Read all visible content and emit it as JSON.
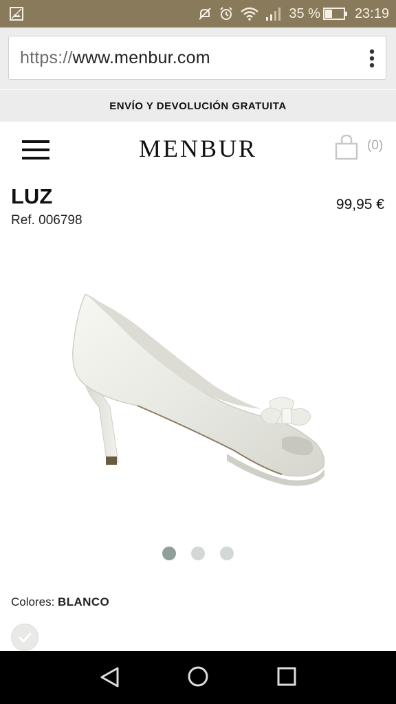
{
  "status_bar": {
    "battery_percent": "35 %",
    "time": "23:19",
    "background": "#8a7a5c",
    "icons": [
      "image-icon",
      "mute-icon",
      "alarm-icon",
      "wifi-icon",
      "signal-icon",
      "battery-icon"
    ]
  },
  "browser": {
    "url_scheme": "https://",
    "url_host": "www.menbur.com"
  },
  "promo": {
    "text": "ENVÍO Y DEVOLUCIÓN GRATUITA"
  },
  "header": {
    "logo": "MENBUR",
    "cart_count": "(0)"
  },
  "product": {
    "name": "LUZ",
    "ref": "Ref. 006798",
    "price": "99,95 €",
    "gallery": {
      "total_images": 3,
      "active_index": 0
    },
    "colors_label": "Colores:",
    "colors_value": "BLANCO"
  },
  "nav_bar": {
    "icons": [
      "back-icon",
      "home-icon",
      "recent-apps-icon"
    ]
  }
}
